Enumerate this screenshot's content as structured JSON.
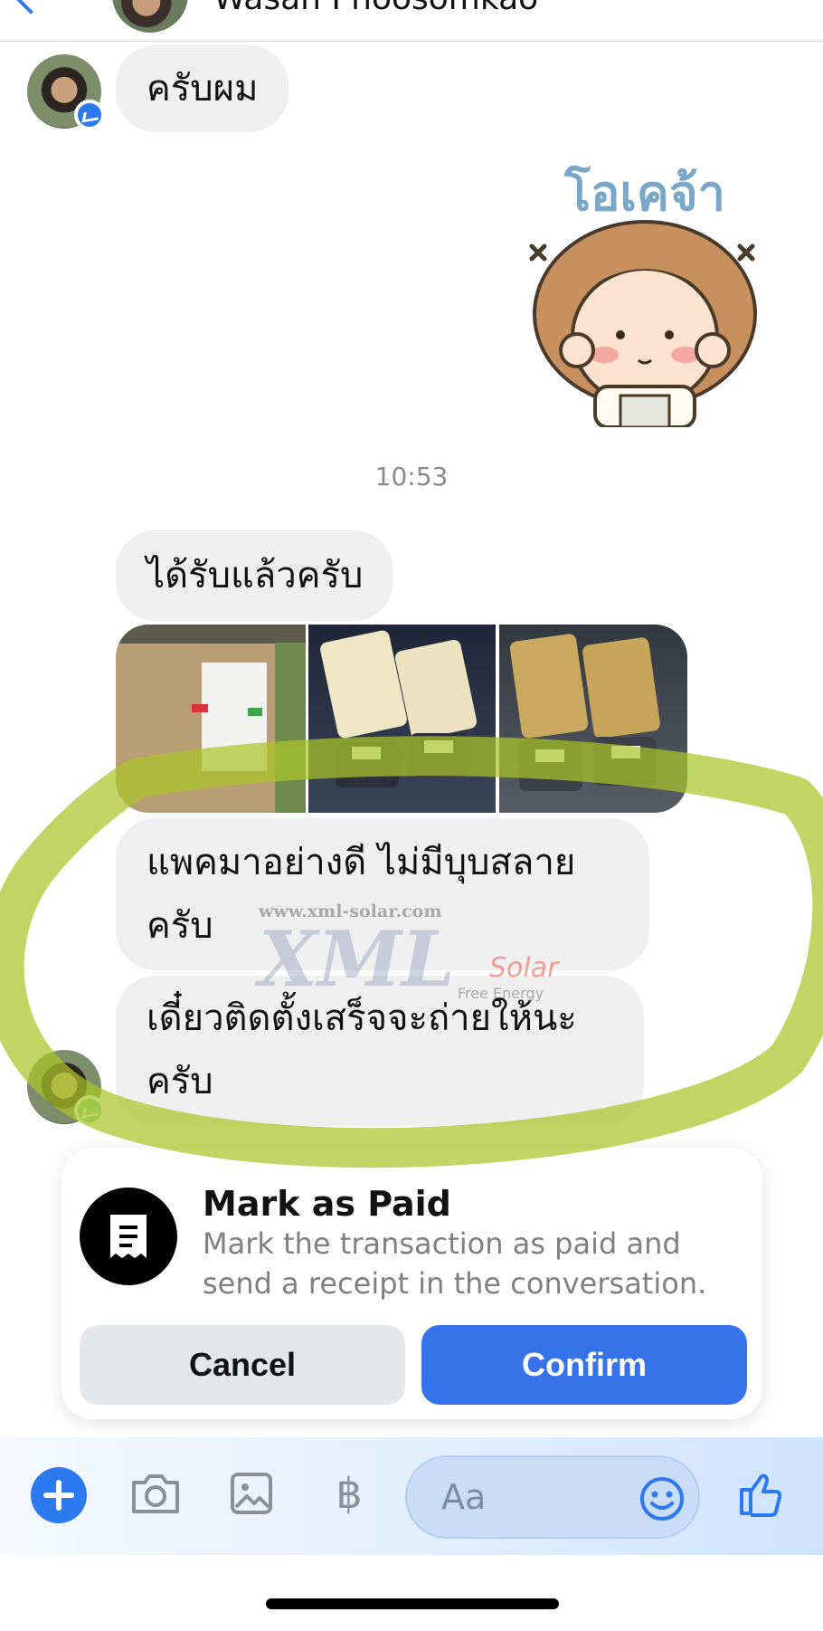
{
  "header": {
    "contact_name": "Wasan Phoosomkao"
  },
  "messages": {
    "msg1": "ครับผม",
    "timestamp": "10:53",
    "msg2": "ได้รับแล้วครับ",
    "msg3_line1": "แพคมาอย่างดี ไม่มีบุบสลาย",
    "msg3_line2": "ครับ",
    "msg4_line1": "เดี๋ยวติดตั้งเสร็จจะถ่ายให้นะ",
    "msg4_line2": "ครับ"
  },
  "sticker": {
    "caption": "โอเคจ้า"
  },
  "action_sheet": {
    "title": "Mark as Paid",
    "description": "Mark the transaction as paid and send a receipt in the conversation.",
    "cancel_label": "Cancel",
    "confirm_label": "Confirm"
  },
  "composer": {
    "placeholder": "Aa",
    "currency_symbol": "฿"
  },
  "watermark": {
    "url": "www.xml-solar.com",
    "brand": "XML",
    "brand_suffix": "Solar",
    "tagline": "Free Energy"
  },
  "colors": {
    "accent": "#2d79f0",
    "confirm": "#3673ea",
    "bubble": "#efefef"
  }
}
